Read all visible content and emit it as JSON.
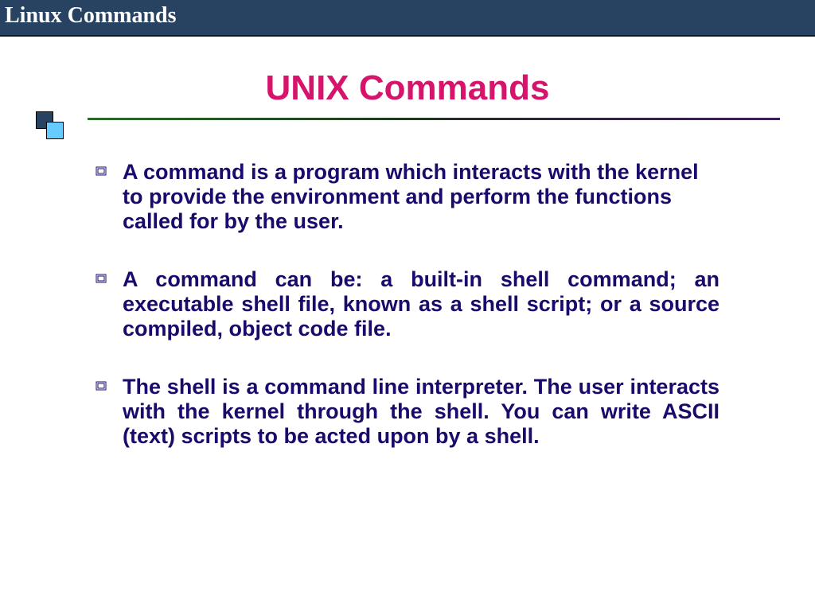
{
  "header": {
    "title": "Linux Commands"
  },
  "slide": {
    "title": "UNIX Commands",
    "bullets": [
      "A command is a program which interacts with the kernel to provide the environment and perform the functions called for by the user.",
      "A command can be: a built-in shell command; an executable shell file, known as a shell script; or a source compiled, object code file.",
      "The shell is a command line interpreter. The user interacts with the kernel through the shell. You can write ASCII (text) scripts to be acted upon by a shell."
    ]
  }
}
